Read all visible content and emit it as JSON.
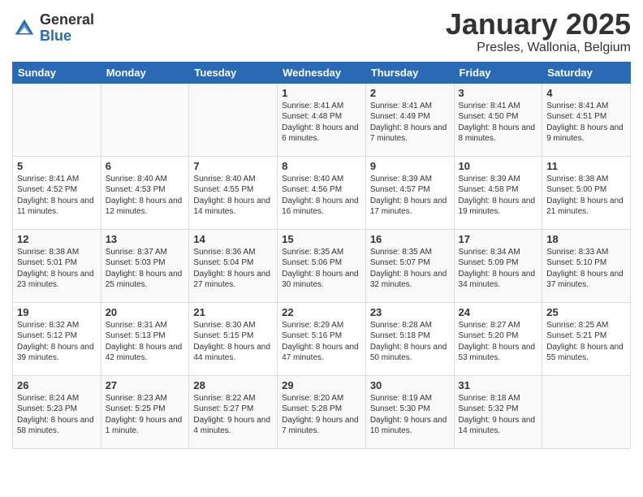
{
  "header": {
    "logo_general": "General",
    "logo_blue": "Blue",
    "month_title": "January 2025",
    "location": "Presles, Wallonia, Belgium"
  },
  "weekdays": [
    "Sunday",
    "Monday",
    "Tuesday",
    "Wednesday",
    "Thursday",
    "Friday",
    "Saturday"
  ],
  "weeks": [
    [
      {
        "day": "",
        "info": ""
      },
      {
        "day": "",
        "info": ""
      },
      {
        "day": "",
        "info": ""
      },
      {
        "day": "1",
        "info": "Sunrise: 8:41 AM\nSunset: 4:48 PM\nDaylight: 8 hours and 6 minutes."
      },
      {
        "day": "2",
        "info": "Sunrise: 8:41 AM\nSunset: 4:49 PM\nDaylight: 8 hours and 7 minutes."
      },
      {
        "day": "3",
        "info": "Sunrise: 8:41 AM\nSunset: 4:50 PM\nDaylight: 8 hours and 8 minutes."
      },
      {
        "day": "4",
        "info": "Sunrise: 8:41 AM\nSunset: 4:51 PM\nDaylight: 8 hours and 9 minutes."
      }
    ],
    [
      {
        "day": "5",
        "info": "Sunrise: 8:41 AM\nSunset: 4:52 PM\nDaylight: 8 hours and 11 minutes."
      },
      {
        "day": "6",
        "info": "Sunrise: 8:40 AM\nSunset: 4:53 PM\nDaylight: 8 hours and 12 minutes."
      },
      {
        "day": "7",
        "info": "Sunrise: 8:40 AM\nSunset: 4:55 PM\nDaylight: 8 hours and 14 minutes."
      },
      {
        "day": "8",
        "info": "Sunrise: 8:40 AM\nSunset: 4:56 PM\nDaylight: 8 hours and 16 minutes."
      },
      {
        "day": "9",
        "info": "Sunrise: 8:39 AM\nSunset: 4:57 PM\nDaylight: 8 hours and 17 minutes."
      },
      {
        "day": "10",
        "info": "Sunrise: 8:39 AM\nSunset: 4:58 PM\nDaylight: 8 hours and 19 minutes."
      },
      {
        "day": "11",
        "info": "Sunrise: 8:38 AM\nSunset: 5:00 PM\nDaylight: 8 hours and 21 minutes."
      }
    ],
    [
      {
        "day": "12",
        "info": "Sunrise: 8:38 AM\nSunset: 5:01 PM\nDaylight: 8 hours and 23 minutes."
      },
      {
        "day": "13",
        "info": "Sunrise: 8:37 AM\nSunset: 5:03 PM\nDaylight: 8 hours and 25 minutes."
      },
      {
        "day": "14",
        "info": "Sunrise: 8:36 AM\nSunset: 5:04 PM\nDaylight: 8 hours and 27 minutes."
      },
      {
        "day": "15",
        "info": "Sunrise: 8:35 AM\nSunset: 5:06 PM\nDaylight: 8 hours and 30 minutes."
      },
      {
        "day": "16",
        "info": "Sunrise: 8:35 AM\nSunset: 5:07 PM\nDaylight: 8 hours and 32 minutes."
      },
      {
        "day": "17",
        "info": "Sunrise: 8:34 AM\nSunset: 5:09 PM\nDaylight: 8 hours and 34 minutes."
      },
      {
        "day": "18",
        "info": "Sunrise: 8:33 AM\nSunset: 5:10 PM\nDaylight: 8 hours and 37 minutes."
      }
    ],
    [
      {
        "day": "19",
        "info": "Sunrise: 8:32 AM\nSunset: 5:12 PM\nDaylight: 8 hours and 39 minutes."
      },
      {
        "day": "20",
        "info": "Sunrise: 8:31 AM\nSunset: 5:13 PM\nDaylight: 8 hours and 42 minutes."
      },
      {
        "day": "21",
        "info": "Sunrise: 8:30 AM\nSunset: 5:15 PM\nDaylight: 8 hours and 44 minutes."
      },
      {
        "day": "22",
        "info": "Sunrise: 8:29 AM\nSunset: 5:16 PM\nDaylight: 8 hours and 47 minutes."
      },
      {
        "day": "23",
        "info": "Sunrise: 8:28 AM\nSunset: 5:18 PM\nDaylight: 8 hours and 50 minutes."
      },
      {
        "day": "24",
        "info": "Sunrise: 8:27 AM\nSunset: 5:20 PM\nDaylight: 8 hours and 53 minutes."
      },
      {
        "day": "25",
        "info": "Sunrise: 8:25 AM\nSunset: 5:21 PM\nDaylight: 8 hours and 55 minutes."
      }
    ],
    [
      {
        "day": "26",
        "info": "Sunrise: 8:24 AM\nSunset: 5:23 PM\nDaylight: 8 hours and 58 minutes."
      },
      {
        "day": "27",
        "info": "Sunrise: 8:23 AM\nSunset: 5:25 PM\nDaylight: 9 hours and 1 minute."
      },
      {
        "day": "28",
        "info": "Sunrise: 8:22 AM\nSunset: 5:27 PM\nDaylight: 9 hours and 4 minutes."
      },
      {
        "day": "29",
        "info": "Sunrise: 8:20 AM\nSunset: 5:28 PM\nDaylight: 9 hours and 7 minutes."
      },
      {
        "day": "30",
        "info": "Sunrise: 8:19 AM\nSunset: 5:30 PM\nDaylight: 9 hours and 10 minutes."
      },
      {
        "day": "31",
        "info": "Sunrise: 8:18 AM\nSunset: 5:32 PM\nDaylight: 9 hours and 14 minutes."
      },
      {
        "day": "",
        "info": ""
      }
    ]
  ]
}
